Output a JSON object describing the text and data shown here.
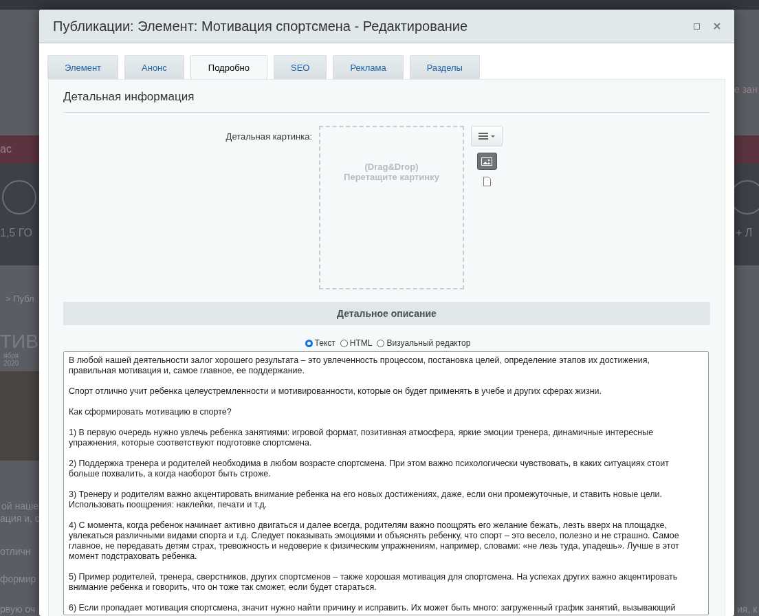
{
  "background_page": {
    "texts": [
      {
        "kind": "button",
        "text": "ас"
      },
      {
        "kind": "stat",
        "text": "1,5 ГО"
      },
      {
        "kind": "crumb",
        "text": "> Публ"
      },
      {
        "kind": "heading",
        "text": "ТИВ"
      },
      {
        "kind": "date",
        "text": "ября"
      },
      {
        "kind": "year",
        "text": "2020"
      },
      {
        "kind": "body",
        "text": "ой наше"
      },
      {
        "kind": "body2",
        "text": "ация и, с"
      },
      {
        "kind": "body3",
        "text": "отличн"
      },
      {
        "kind": "body4",
        "text": "формир"
      },
      {
        "kind": "body5",
        "text": "рвую оч"
      },
      {
        "kind": "rbutton",
        "text": "е зан"
      },
      {
        "kind": "rstat",
        "text": "+ Л"
      },
      {
        "kind": "rbody",
        "text": "ия, к"
      }
    ]
  },
  "window": {
    "title": "Публикации: Элемент: Мотивация спортсмена - Редактирование"
  },
  "tabs": [
    {
      "label": "Элемент",
      "selected": false
    },
    {
      "label": "Анонс",
      "selected": false
    },
    {
      "label": "Подробно",
      "selected": true
    },
    {
      "label": "SEO",
      "selected": false
    },
    {
      "label": "Реклама",
      "selected": false
    },
    {
      "label": "Разделы",
      "selected": false
    }
  ],
  "section_title": "Детальная информация",
  "picture": {
    "label": "Детальная картинка:",
    "drop_hint": "(Drag&Drop)",
    "drop_text": "Перетащите картинку"
  },
  "description": {
    "header": "Детальное описание",
    "modes": [
      {
        "label": "Текст",
        "selected": true
      },
      {
        "label": "HTML",
        "selected": false
      },
      {
        "label": "Визуальный редактор",
        "selected": false
      }
    ],
    "value": "В любой нашей деятельности залог хорошего результата – это увлеченность процессом, постановка целей, определение этапов их достижения, правильная мотивация и, самое главное, ее поддержание.\n\nСпорт отлично учит ребенка целеустремленности и мотивированности, которые он будет применять в учебе и других сферах жизни.\n\nКак сформировать мотивацию в спорте?\n\n1) В первую очередь нужно увлечь ребенка занятиями: игровой формат, позитивная атмосфера, яркие эмоции тренера, динамичные интересные упражнения, которые соответствуют подготовке спортсмена.\n\n2) Поддержка тренера и родителей необходима в любом возрасте спортсмена. При этом важно психологически чувствовать, в каких ситуациях стоит больше похвалить, а когда наоборот быть строже.\n\n3) Тренеру и родителям важно акцентировать внимание ребенка на его новых достижениях, даже, если они промежуточные, и ставить новые цели. Использовать поощрения: наклейки, печати и т.д.\n\n4) С момента, когда ребенок начинает активно двигаться и далее всегда, родителям важно поощрять его желание бежать, лезть вверх на площадке, увлекаться различными видами спорта и т.д. Следует показывать эмоциями и объяснять ребенку, что спорт – это весело, полезно и не страшно. Самое главное, не передавать детям страх, тревожность и недоверие к физическим упражнениям, например, словами: «не лезь туда, упадешь». Лучше в этот момент подстраховать ребенка.\n\n5) Пример родителей, тренера, сверстников, других спортсменов – также хорошая мотивация для спортсмена. На успехах других важно акцентировать внимание ребенка и говорить, что он тоже так сможет, если будет стараться.\n\n6) Если пропадает мотивация спортсмена, значит нужно найти причину и исправить. Их может быть много: загруженный график занятий, вызывающий"
  }
}
